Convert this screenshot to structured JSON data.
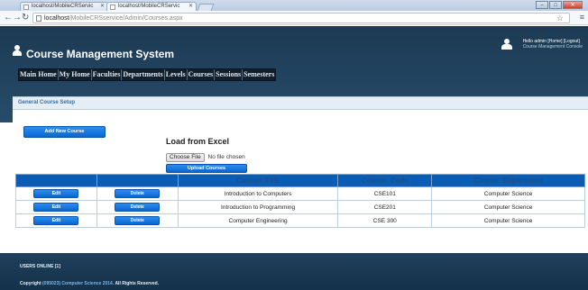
{
  "browser": {
    "tabs": [
      {
        "label": "localhost/MobileCRServic"
      },
      {
        "label": "localhost/MobileCRServic"
      }
    ],
    "url_host": "localhost",
    "url_path": "/MobileCRSservice/Admin/Courses.aspx"
  },
  "header": {
    "site_title": "Course Management System",
    "user_greeting": "Hello admin",
    "home_link": "Home",
    "logout_link": "Logout",
    "user_subtitle": "Course Management Console"
  },
  "nav": {
    "items": [
      "Main Home",
      "My Home",
      "Faculties",
      "Departments",
      "Levels",
      "Courses",
      "Sessions",
      "Semesters"
    ]
  },
  "panel": {
    "title": "General Course Setup",
    "add_button": "Add New Course",
    "excel_title": "Load from Excel",
    "choose_file": "Choose File",
    "no_file": "No file chosen",
    "upload_button": "Upload Courses"
  },
  "table": {
    "headers": [
      "",
      "",
      "Course_Title",
      "Course_Code",
      "Course_Department"
    ],
    "edit_label": "Edit",
    "delete_label": "Delete",
    "rows": [
      {
        "title": "Introduction to Computers",
        "code": "CSE101",
        "dept": "Computer Science"
      },
      {
        "title": "Introduction to Programming",
        "code": "CSE201",
        "dept": "Computer Science"
      },
      {
        "title": "Computer Engineering",
        "code": "CSE 300",
        "dept": "Computer Science"
      }
    ]
  },
  "footer": {
    "users_online": "USERS ONLINE [1]",
    "copyright_prefix": "Copyright",
    "copyright_highlight": "(095023) Computer Science 2014.",
    "copyright_suffix": "All Rights Reserved."
  }
}
